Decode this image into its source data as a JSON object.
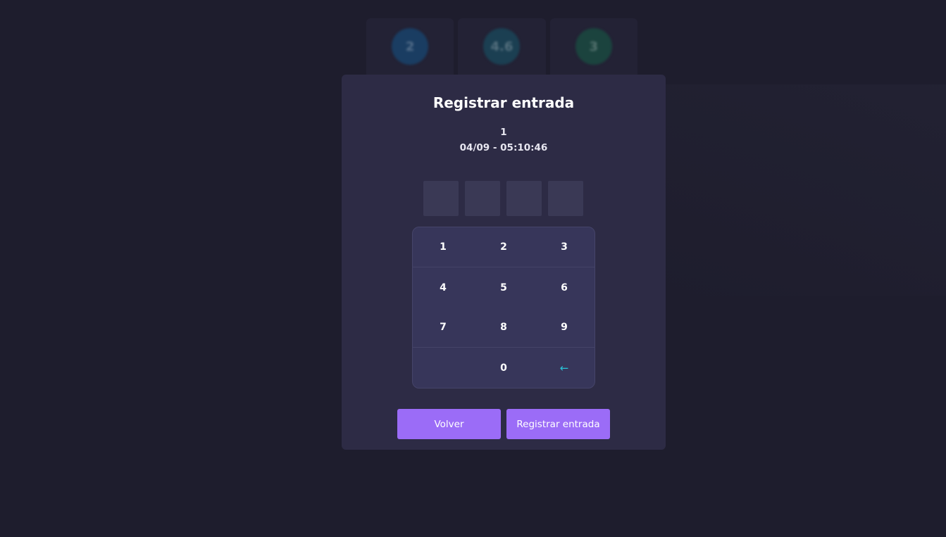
{
  "background": {
    "stats": [
      "2",
      "4.6",
      "3"
    ]
  },
  "modal": {
    "title": "Registrar entrada",
    "line1": "1",
    "line2": "04/09 - 05:10:46",
    "pin_boxes": [
      "",
      "",
      "",
      ""
    ],
    "keypad": {
      "rows": [
        [
          "1",
          "2",
          "3"
        ],
        [
          "4",
          "5",
          "6"
        ],
        [
          "7",
          "8",
          "9"
        ],
        [
          "",
          "0",
          "←"
        ]
      ]
    },
    "buttons": {
      "back_label": "Volver",
      "submit_label": "Registrar entrada"
    }
  },
  "colors": {
    "page_bg": "#1e1d2d",
    "modal_bg": "#2d2b45",
    "keypad_bg": "#37365a",
    "accent": "#9b6cf7",
    "backspace": "#2ac3d8"
  }
}
